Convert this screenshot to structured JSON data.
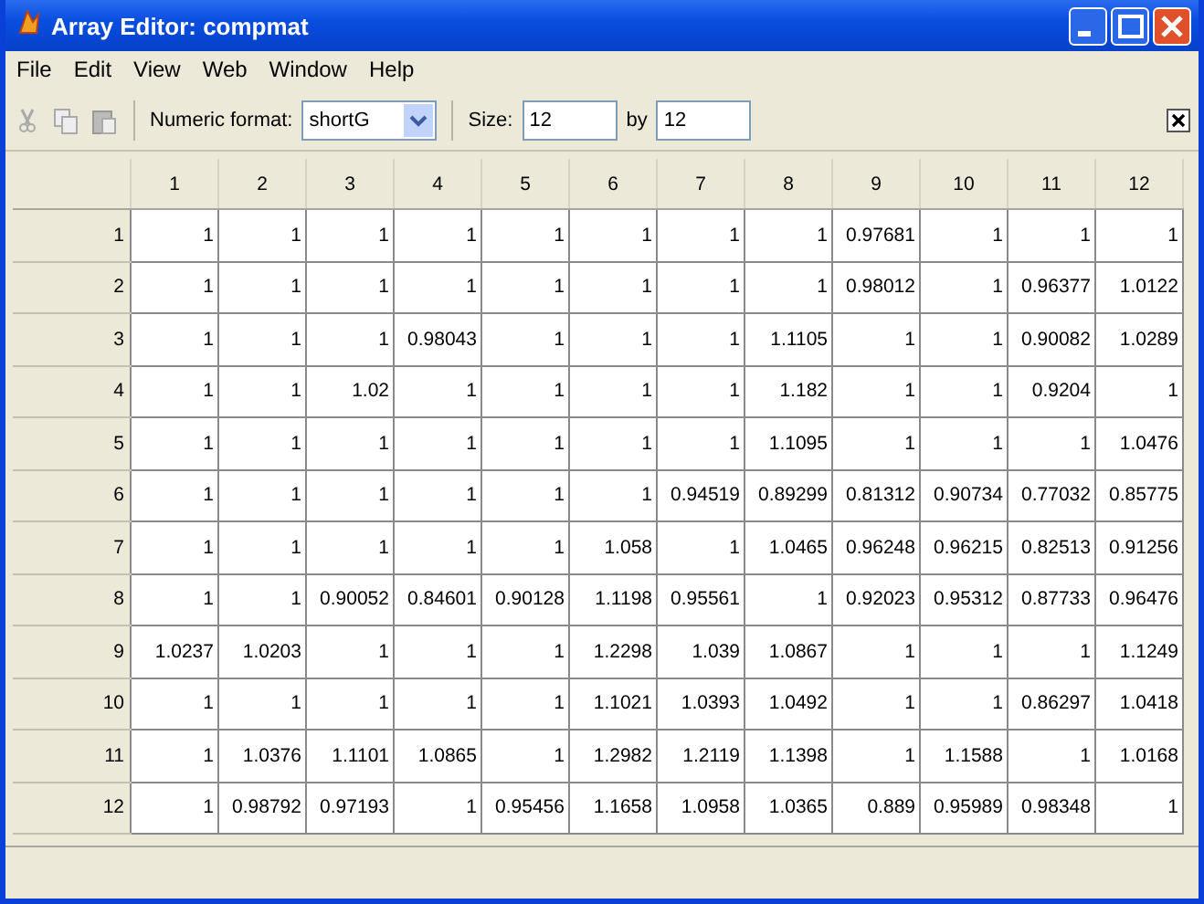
{
  "window": {
    "title": "Array Editor: compmat"
  },
  "menu": [
    "File",
    "Edit",
    "View",
    "Web",
    "Window",
    "Help"
  ],
  "toolbar": {
    "numeric_format_label": "Numeric format:",
    "numeric_format": "shortG",
    "size_label": "Size:",
    "rows": "12",
    "by_label": "by",
    "cols": "12"
  },
  "table": {
    "columns": [
      "1",
      "2",
      "3",
      "4",
      "5",
      "6",
      "7",
      "8",
      "9",
      "10",
      "11",
      "12"
    ],
    "rows": [
      {
        "label": "1",
        "cells": [
          "1",
          "1",
          "1",
          "1",
          "1",
          "1",
          "1",
          "1",
          "0.97681",
          "1",
          "1",
          "1"
        ]
      },
      {
        "label": "2",
        "cells": [
          "1",
          "1",
          "1",
          "1",
          "1",
          "1",
          "1",
          "1",
          "0.98012",
          "1",
          "0.96377",
          "1.0122"
        ]
      },
      {
        "label": "3",
        "cells": [
          "1",
          "1",
          "1",
          "0.98043",
          "1",
          "1",
          "1",
          "1.1105",
          "1",
          "1",
          "0.90082",
          "1.0289"
        ]
      },
      {
        "label": "4",
        "cells": [
          "1",
          "1",
          "1.02",
          "1",
          "1",
          "1",
          "1",
          "1.182",
          "1",
          "1",
          "0.9204",
          "1"
        ]
      },
      {
        "label": "5",
        "cells": [
          "1",
          "1",
          "1",
          "1",
          "1",
          "1",
          "1",
          "1.1095",
          "1",
          "1",
          "1",
          "1.0476"
        ]
      },
      {
        "label": "6",
        "cells": [
          "1",
          "1",
          "1",
          "1",
          "1",
          "1",
          "0.94519",
          "0.89299",
          "0.81312",
          "0.90734",
          "0.77032",
          "0.85775"
        ]
      },
      {
        "label": "7",
        "cells": [
          "1",
          "1",
          "1",
          "1",
          "1",
          "1.058",
          "1",
          "1.0465",
          "0.96248",
          "0.96215",
          "0.82513",
          "0.91256"
        ]
      },
      {
        "label": "8",
        "cells": [
          "1",
          "1",
          "0.90052",
          "0.84601",
          "0.90128",
          "1.1198",
          "0.95561",
          "1",
          "0.92023",
          "0.95312",
          "0.87733",
          "0.96476"
        ]
      },
      {
        "label": "9",
        "cells": [
          "1.0237",
          "1.0203",
          "1",
          "1",
          "1",
          "1.2298",
          "1.039",
          "1.0867",
          "1",
          "1",
          "1",
          "1.1249"
        ]
      },
      {
        "label": "10",
        "cells": [
          "1",
          "1",
          "1",
          "1",
          "1",
          "1.1021",
          "1.0393",
          "1.0492",
          "1",
          "1",
          "0.86297",
          "1.0418"
        ]
      },
      {
        "label": "11",
        "cells": [
          "1",
          "1.0376",
          "1.1101",
          "1.0865",
          "1",
          "1.2982",
          "1.2119",
          "1.1398",
          "1",
          "1.1588",
          "1",
          "1.0168"
        ]
      },
      {
        "label": "12",
        "cells": [
          "1",
          "0.98792",
          "0.97193",
          "1",
          "0.95456",
          "1.1658",
          "1.0958",
          "1.0365",
          "0.889",
          "0.95989",
          "0.98348",
          "1"
        ]
      }
    ]
  }
}
